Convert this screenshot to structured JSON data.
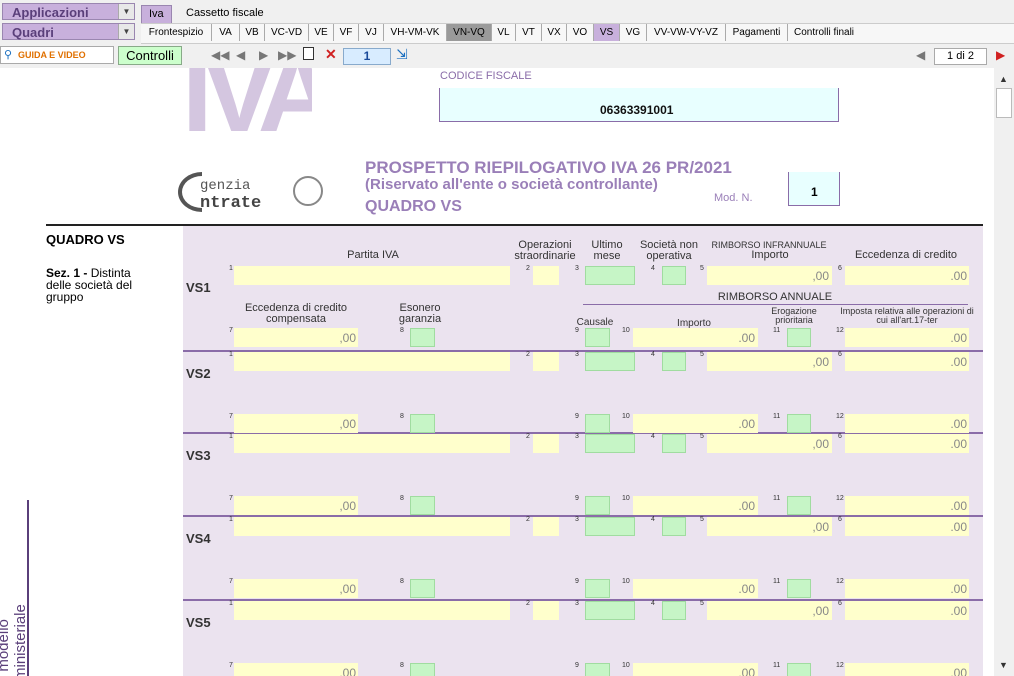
{
  "applicazioni_label": "Applicazioni",
  "quadri_label": "Quadri",
  "main_tabs": [
    "Iva",
    "Cassetto fiscale"
  ],
  "quadri_tabs": [
    "Frontespizio",
    "VA",
    "VB",
    "VC-VD",
    "VE",
    "VF",
    "VJ",
    "VH-VM-VK",
    "VN-VQ",
    "VL",
    "VT",
    "VX",
    "VO",
    "VS",
    "VG",
    "VV-VW-VY-VZ",
    "Pagamenti",
    "Controlli finali"
  ],
  "guida_label": "GUIDA E VIDEO",
  "controlli_label": "Controlli",
  "page_input": "1",
  "page_indicator": "1 di 2",
  "codice_fiscale_label": "CODICE FISCALE",
  "codice_fiscale_value": "06363391001",
  "logo_iva": "IVA",
  "logo_agenzia": "genzia",
  "logo_entrate": "ntrate",
  "title_main": "PROSPETTO RIEPILOGATIVO IVA 26 PR/2021",
  "title_sub": "(Riservato all'ente o società controllante)",
  "title_quadro": "QUADRO VS",
  "mod_n_label": "Mod. N.",
  "mod_n_value": "1",
  "left_title": "QUADRO VS",
  "sez_bold": "Sez. 1 -",
  "sez_text": "Distinta delle società del gruppo",
  "side_label": "I modello ministeriale",
  "headers": {
    "partita_iva": "Partita IVA",
    "operazioni": "Operazioni straordinarie",
    "ultimo": "Ultimo mese",
    "societa": "Società non operativa",
    "rimborso_infr": "RIMBORSO INFRANNUALE",
    "importo": "Importo",
    "eccedenza": "Eccedenza di credito",
    "eccedenza_comp": "Eccedenza di credito compensata",
    "esonero": "Esonero garanzia",
    "rimborso_annuale": "RIMBORSO ANNUALE",
    "causale": "Causale",
    "importo2": "Importo",
    "erogazione": "Erogazione prioritaria",
    "imposta": "Imposta relativa alle operazioni di cui all'art.17-ter"
  },
  "rows": [
    "VS1",
    "VS2",
    "VS3",
    "VS4",
    "VS5"
  ],
  "zero": ",00",
  "zero_dot": ".00",
  "field_nums": [
    "1",
    "2",
    "3",
    "4",
    "5",
    "6",
    "7",
    "8",
    "9",
    "10",
    "11",
    "12"
  ]
}
